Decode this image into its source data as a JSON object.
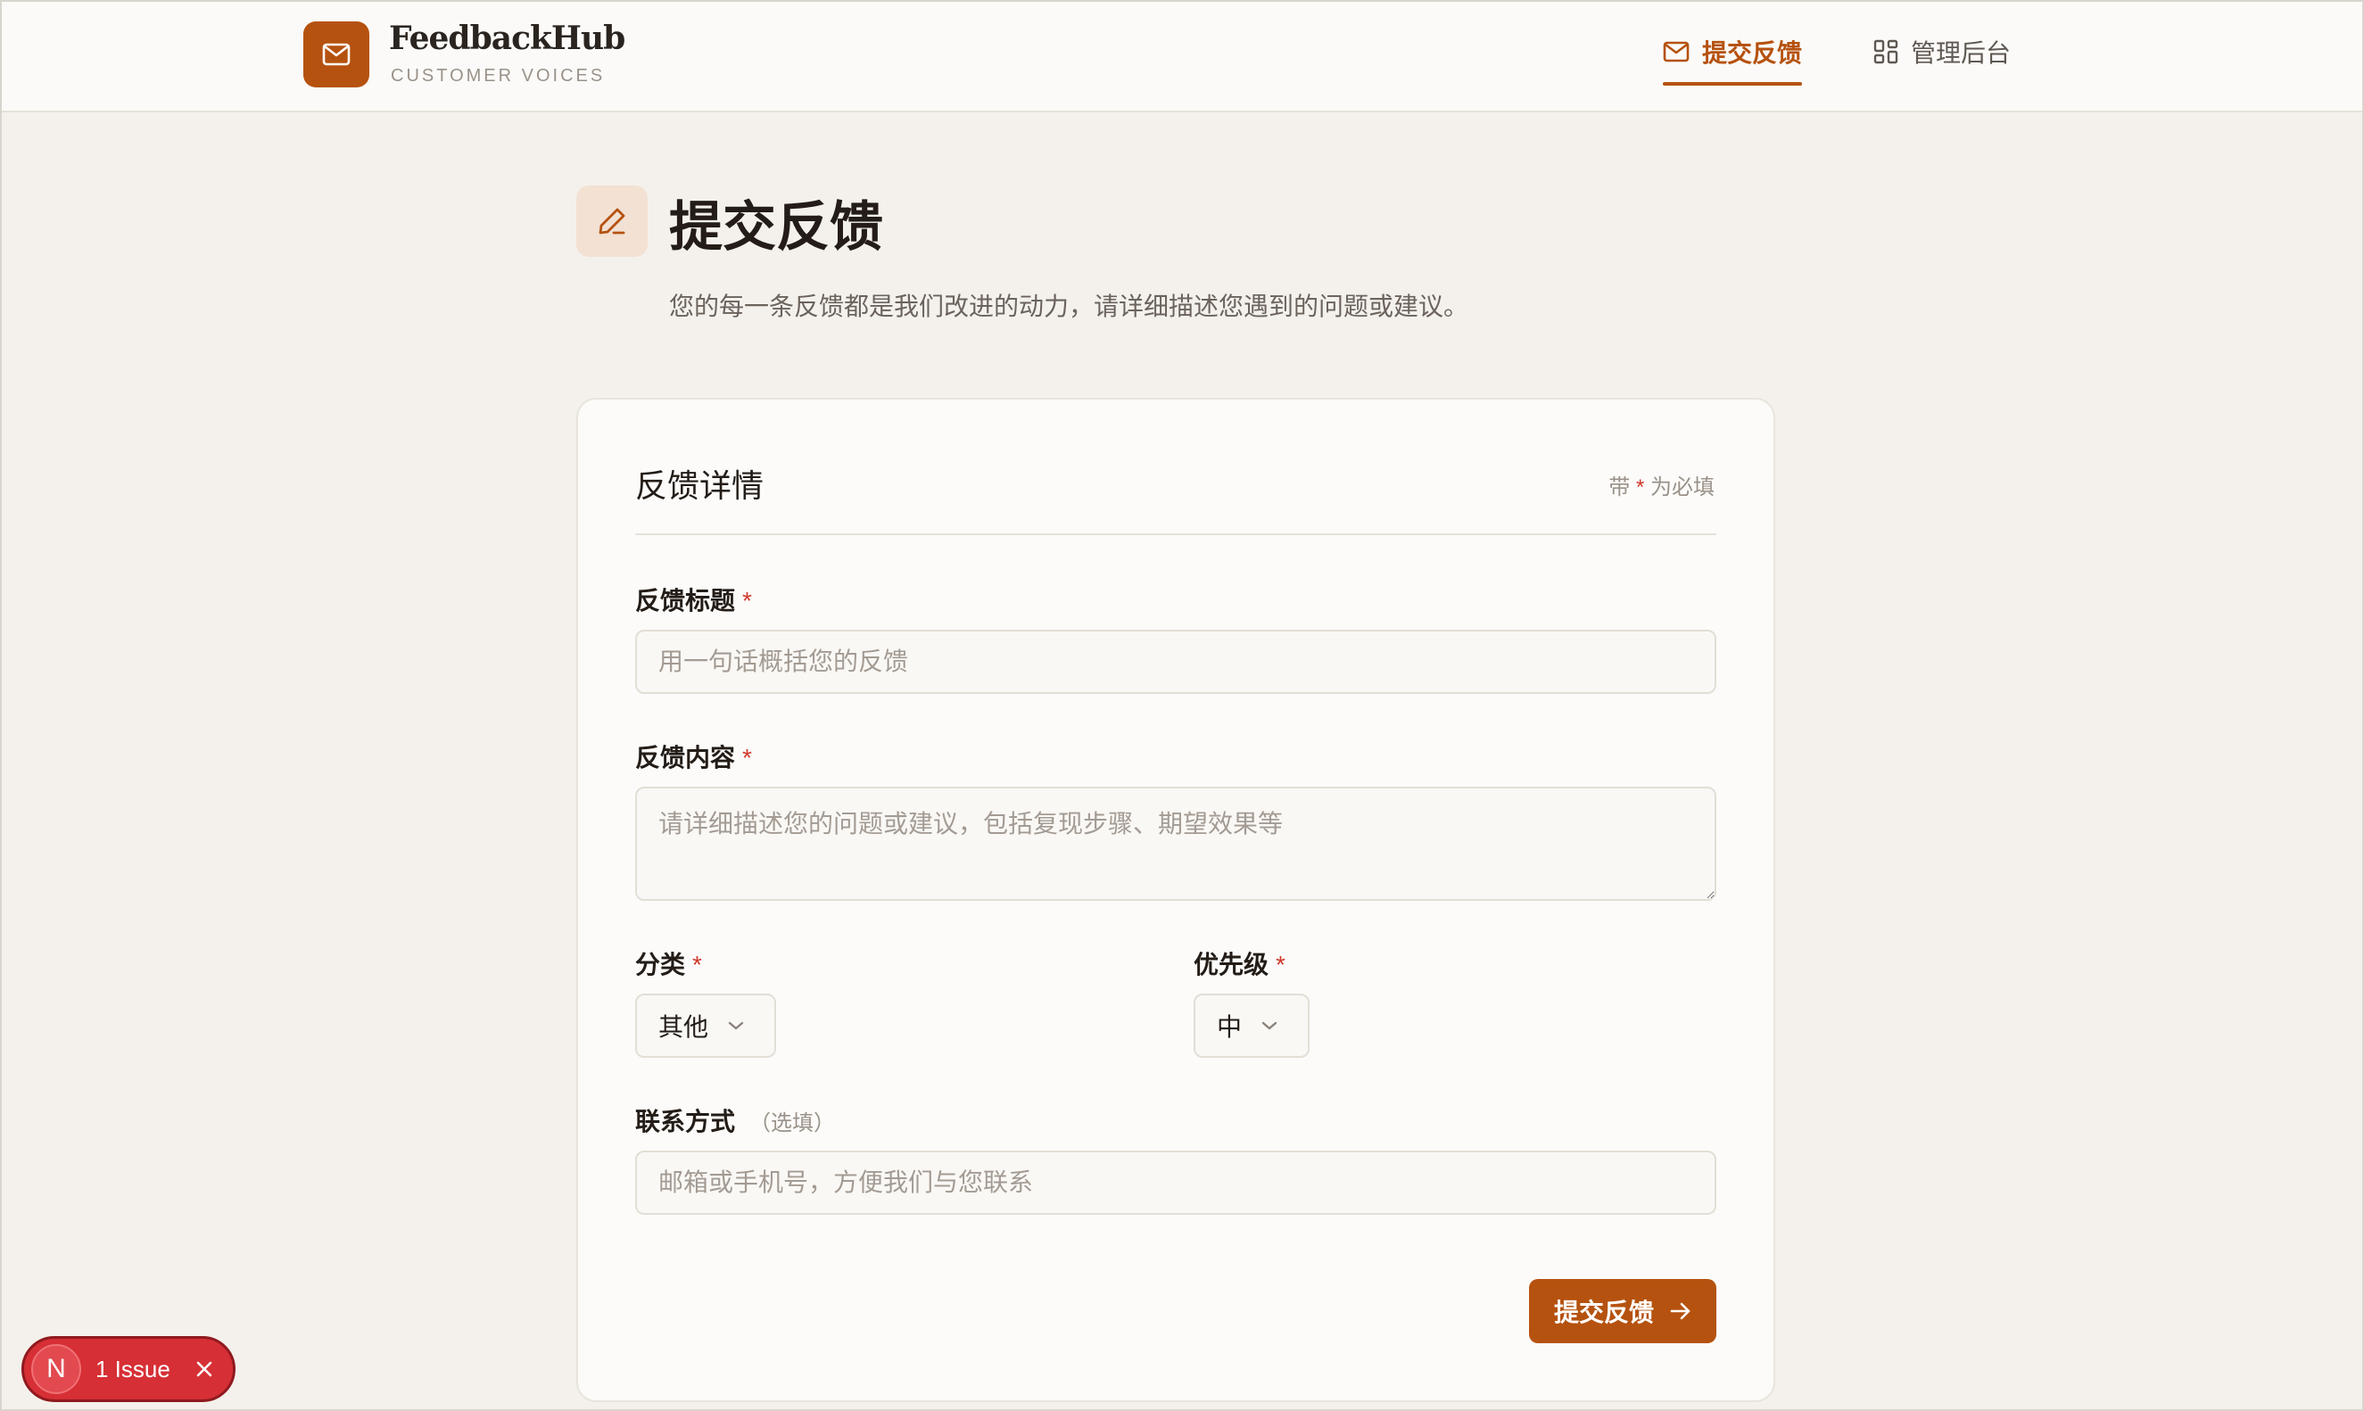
{
  "header": {
    "brand_name": "FeedbackHub",
    "brand_sub": "CUSTOMER VOICES",
    "nav": [
      {
        "label": "提交反馈",
        "icon": "mail-icon",
        "active": true
      },
      {
        "label": "管理后台",
        "icon": "dashboard-grid-icon",
        "active": false
      }
    ]
  },
  "page": {
    "title": "提交反馈",
    "description": "您的每一条反馈都是我们改进的动力，请详细描述您遇到的问题或建议。"
  },
  "form": {
    "card_title": "反馈详情",
    "required_note_prefix": "带",
    "required_note_star": "*",
    "required_note_suffix": "为必填",
    "title_label": "反馈标题",
    "title_placeholder": "用一句话概括您的反馈",
    "content_label": "反馈内容",
    "content_placeholder": "请详细描述您的问题或建议，包括复现步骤、期望效果等",
    "category_label": "分类",
    "category_value": "其他",
    "priority_label": "优先级",
    "priority_value": "中",
    "contact_label": "联系方式",
    "contact_optional": "（选填）",
    "contact_placeholder": "邮箱或手机号，方便我们与您联系",
    "required_star": "*",
    "submit_label": "提交反馈"
  },
  "issue_badge": {
    "letter": "N",
    "label": "1 Issue"
  },
  "colors": {
    "accent": "#b5520f",
    "background": "#f4f1ec",
    "required": "#d0392b",
    "issue": "#d62f35"
  }
}
